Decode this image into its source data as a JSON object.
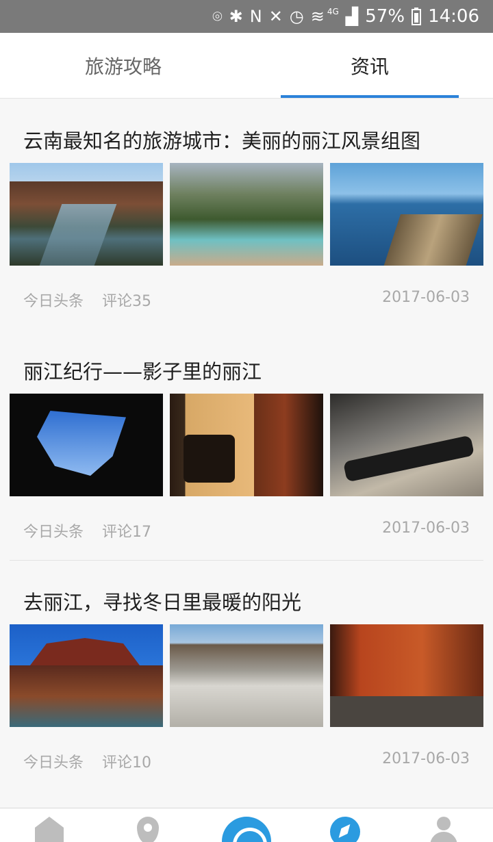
{
  "status_bar": {
    "battery": "57%",
    "time": "14:06",
    "network": "4G",
    "icons": [
      "location-icon",
      "bluetooth-icon",
      "nfc-icon",
      "vibrate-icon",
      "alarm-icon",
      "wifi-icon",
      "signal-icon",
      "battery-icon"
    ]
  },
  "tabs": [
    {
      "label": "旅游攻略",
      "active": false
    },
    {
      "label": "资讯",
      "active": true
    }
  ],
  "accent_color": "#2b82d9",
  "articles": [
    {
      "title": "云南最知名的旅游城市：美丽的丽江风景组图",
      "source": "今日头条",
      "comments": "评论35",
      "date": "2017-06-03",
      "images": [
        "canal-photo",
        "river-photo",
        "boats-photo"
      ]
    },
    {
      "title": "丽江纪行——影子里的丽江",
      "source": "今日头条",
      "comments": "评论17",
      "date": "2017-06-03",
      "images": [
        "roof-silhouette-photo",
        "lantern-shadow-photo",
        "street-shadow-photo"
      ]
    },
    {
      "title": "去丽江，寻找冬日里最暖的阳光",
      "source": "今日头条",
      "comments": "评论10",
      "date": "2017-06-03",
      "images": [
        "gate-photo",
        "stone-street-photo",
        "red-wall-shadow-photo"
      ]
    }
  ],
  "bottom_nav": [
    {
      "icon": "home-icon"
    },
    {
      "icon": "location-icon"
    },
    {
      "icon": "wifi-icon",
      "active": true
    },
    {
      "icon": "compass-icon"
    },
    {
      "icon": "user-icon"
    }
  ]
}
